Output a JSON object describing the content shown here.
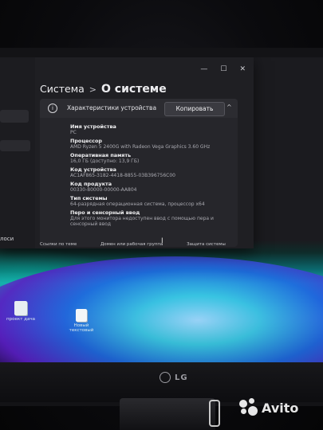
{
  "window": {
    "breadcrumb_parent": "Система",
    "breadcrumb_separator": ">",
    "breadcrumb_current": "О системе",
    "controls": [
      "—",
      "☐",
      "✕"
    ],
    "sidebar_label": "лоси"
  },
  "card": {
    "title": "Характеристики устройства",
    "copy_label": "Копировать",
    "chevron": "^",
    "properties": [
      {
        "label": "Имя устройства",
        "value": "PC"
      },
      {
        "label": "Процессор",
        "value": "AMD Ryzen 5 2400G with Radeon Vega Graphics 3.60 GHz"
      },
      {
        "label": "Оперативная память",
        "value": "16,0 ГБ (доступно: 13,9 ГБ)"
      },
      {
        "label": "Код устройства",
        "value": "AC1AF865-3182-4418-8855-03B396756C00"
      },
      {
        "label": "Код продукта",
        "value": "00330-80000-00000-AA804"
      },
      {
        "label": "Тип системы",
        "value": "64-разрядная операционная система, процессор x64"
      },
      {
        "label": "Перо и сенсорный ввод",
        "value": "Для этого монитора недоступен ввод с помощью пера и сенсорный ввод"
      }
    ]
  },
  "related": [
    "Ссылки по теме",
    "Домен или рабочая группа",
    "Защита системы"
  ],
  "desktop_icons": [
    {
      "label": "проект дача"
    },
    {
      "label": "Новый текстовый"
    }
  ],
  "brand": {
    "logo_text": "LG"
  },
  "watermark": {
    "text": "Avito"
  }
}
